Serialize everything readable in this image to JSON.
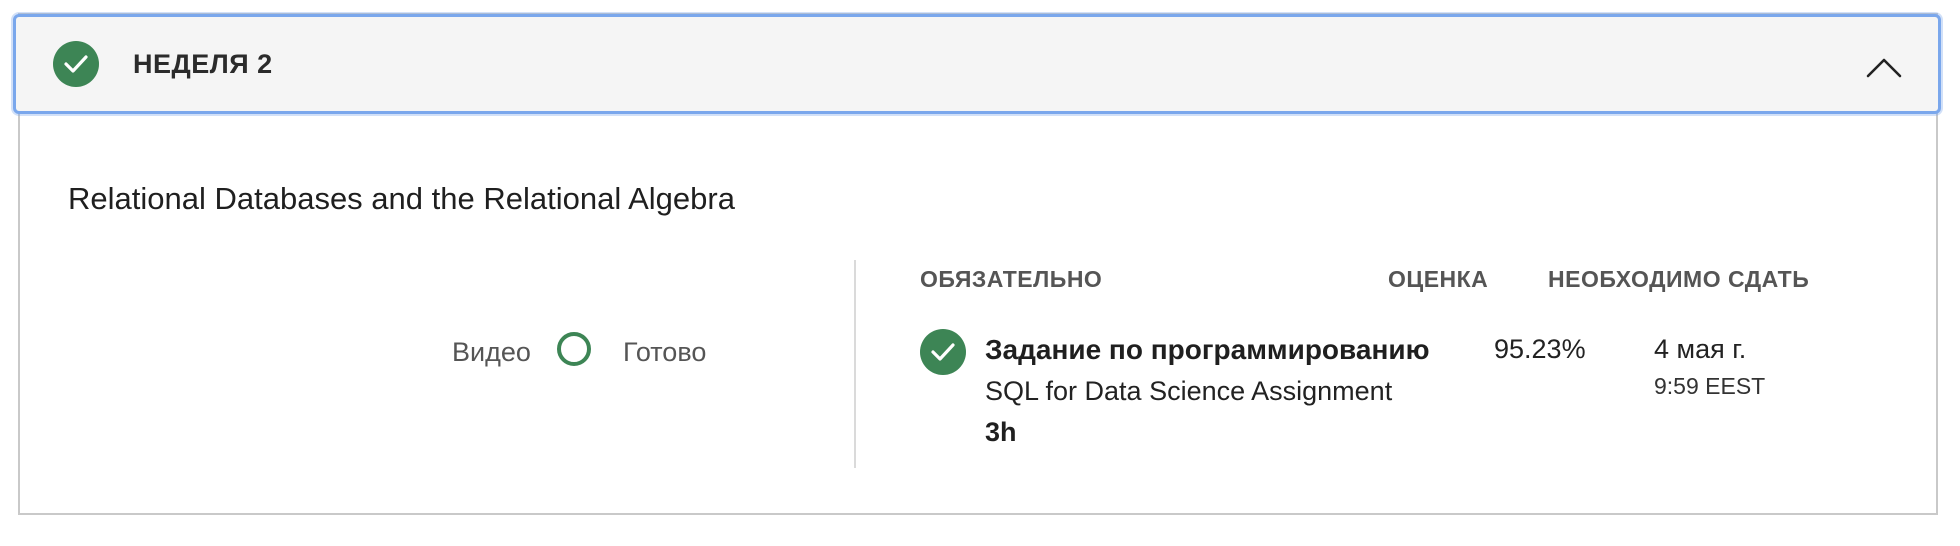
{
  "week": {
    "title": "НЕДЕЛЯ 2",
    "status_icon": "check-circle-icon",
    "collapse_icon": "chevron-up-icon"
  },
  "module": {
    "title": "Relational Databases and the Relational Algebra",
    "legend": {
      "video_label": "Видео",
      "ring_icon": "progress-ring-icon",
      "done_label": "Готово"
    }
  },
  "table": {
    "headers": {
      "required": "ОБЯЗАТЕЛЬНО",
      "grade": "ОЦЕНКА",
      "due": "НЕОБХОДИМО СДАТЬ"
    },
    "items": [
      {
        "status_icon": "check-circle-icon",
        "type": "Задание по программированию",
        "name": "SQL for Data Science Assignment",
        "duration": "3h",
        "grade": "95.23%",
        "due_date": "4 мая г.",
        "due_time": "9:59 EEST"
      }
    ]
  },
  "colors": {
    "accent_green": "#3d8555",
    "focus_blue": "#7aa7ec",
    "header_bg": "#f5f5f5"
  }
}
